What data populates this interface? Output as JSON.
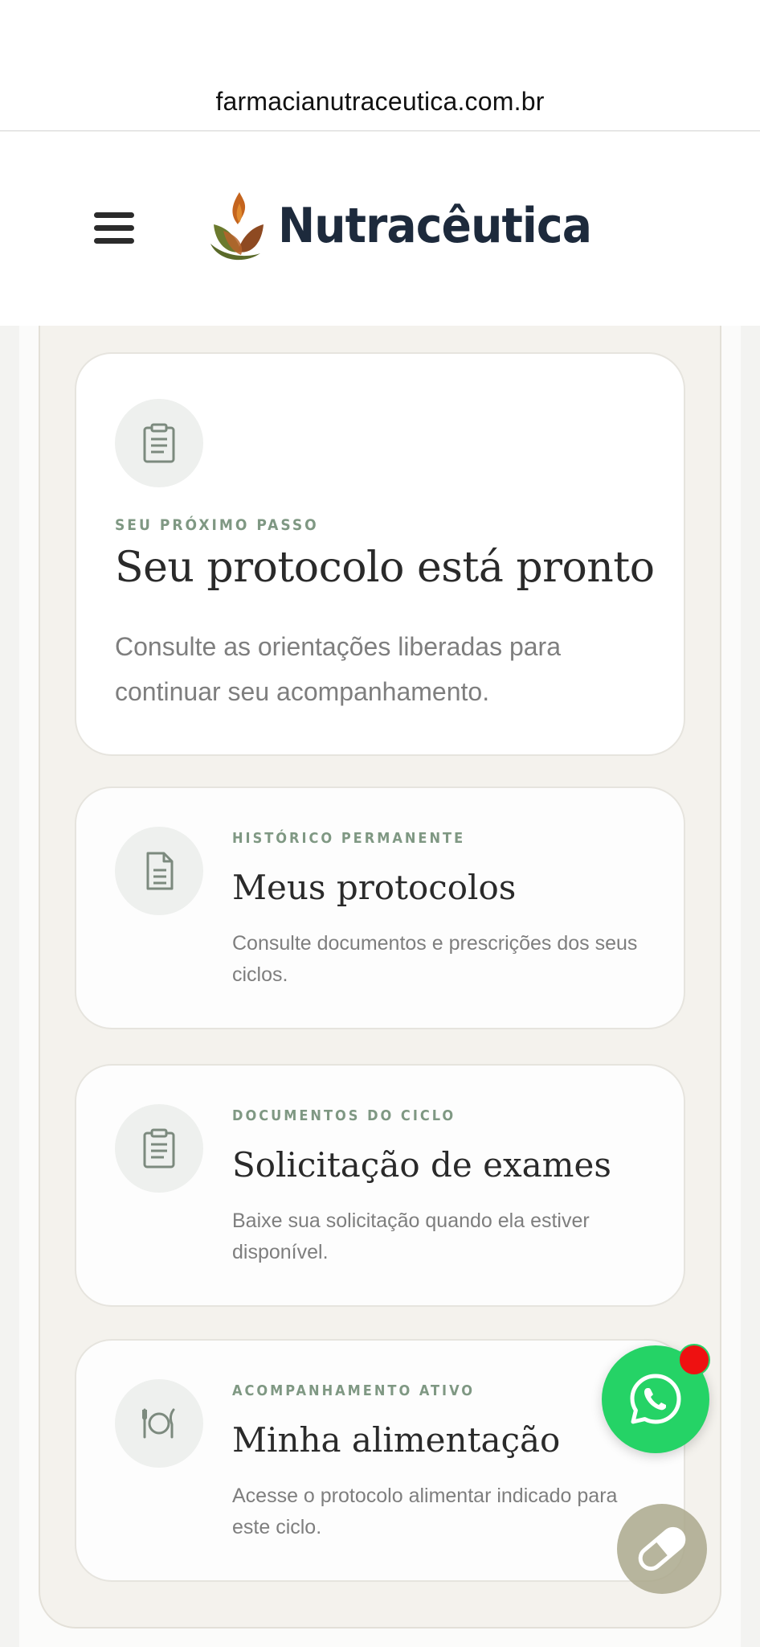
{
  "browser": {
    "url": "farmacianutraceutica.com.br"
  },
  "header": {
    "brand_name": "Nutracêutica",
    "menu_icon": "hamburger-menu-icon",
    "logo_icon": "leaf-flame-logo-icon"
  },
  "cards": [
    {
      "eyebrow": "SEU PRÓXIMO PASSO",
      "title": "Seu protocolo está pronto",
      "description": "Consulte as orientações liberadas para continuar seu acompanhamento.",
      "icon": "clipboard-icon"
    },
    {
      "eyebrow": "HISTÓRICO PERMANENTE",
      "title": "Meus protocolos",
      "description": "Consulte documentos e prescrições dos seus ciclos.",
      "icon": "document-icon"
    },
    {
      "eyebrow": "DOCUMENTOS DO CICLO",
      "title": "Solicitação de exames",
      "description": "Baixe sua solicitação quando ela estiver disponível.",
      "icon": "clipboard-icon"
    },
    {
      "eyebrow": "ACOMPANHAMENTO ATIVO",
      "title": "Minha alimentação",
      "description": "Acesse o protocolo alimentar indicado para este ciclo.",
      "icon": "plate-cutlery-icon"
    }
  ],
  "floating": {
    "whatsapp_icon": "whatsapp-icon",
    "pill_icon": "pill-icon"
  },
  "colors": {
    "whatsapp_green": "#25d366",
    "notification_red": "#ee1111",
    "eyebrow_green": "#7f9883",
    "brand_navy": "#1d2a3c"
  }
}
